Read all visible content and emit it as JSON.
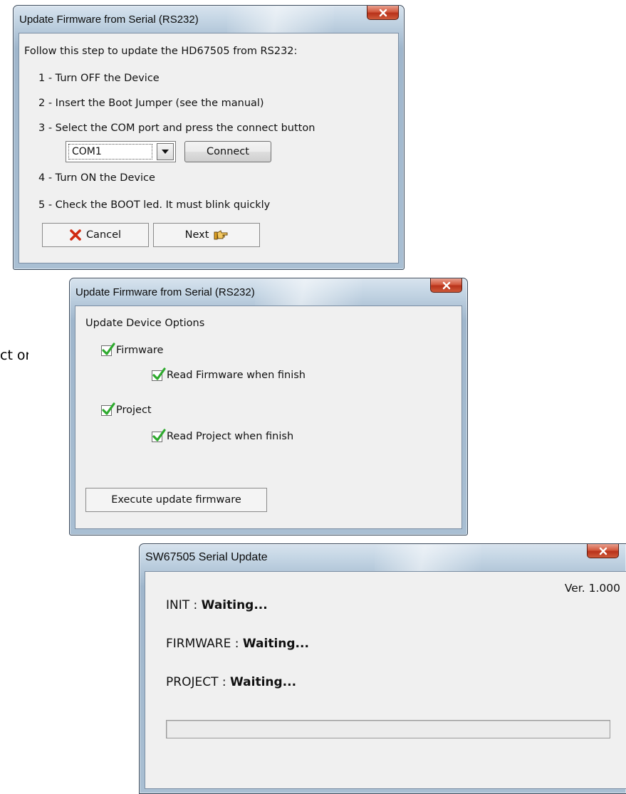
{
  "background_partial_text": "ct or",
  "dialog1": {
    "title": "Update Firmware from Serial (RS232)",
    "intro": "Follow this step to update the HD67505 from RS232:",
    "steps": [
      "1 - Turn OFF the Device",
      "2 - Insert the Boot Jumper (see the manual)",
      "3 - Select the  COM port and press the connect button",
      "4 - Turn ON the Device",
      "5 - Check the BOOT led. It must blink quickly"
    ],
    "com_port_value": "COM1",
    "connect_label": "Connect",
    "cancel_label": "Cancel",
    "next_label": "Next",
    "icons": {
      "close": "close-icon",
      "cancel": "red-x-icon",
      "next": "pointing-hand-icon",
      "dropdown": "chevron-down-icon"
    }
  },
  "dialog2": {
    "title": "Update Firmware from Serial (RS232)",
    "section_label": "Update Device Options",
    "options": {
      "firmware": {
        "label": "Firmware",
        "checked": true
      },
      "read_firmware": {
        "label": "Read Firmware when finish",
        "checked": true
      },
      "project": {
        "label": "Project",
        "checked": true
      },
      "read_project": {
        "label": "Read Project when finish",
        "checked": true
      }
    },
    "execute_label": "Execute update firmware"
  },
  "dialog3": {
    "title": "SW67505 Serial Update",
    "version": "Ver. 1.000",
    "init_label": "INIT :",
    "init_status": "Waiting...",
    "firmware_label": "FIRMWARE :",
    "firmware_status": "Waiting...",
    "project_label": "PROJECT :",
    "project_status": "Waiting...",
    "progress_fraction": 0
  },
  "colors": {
    "close_button": "#c8432a",
    "check_green": "#2eaa2e",
    "cancel_x": "#d02a10",
    "next_hand": "#e0a020"
  }
}
